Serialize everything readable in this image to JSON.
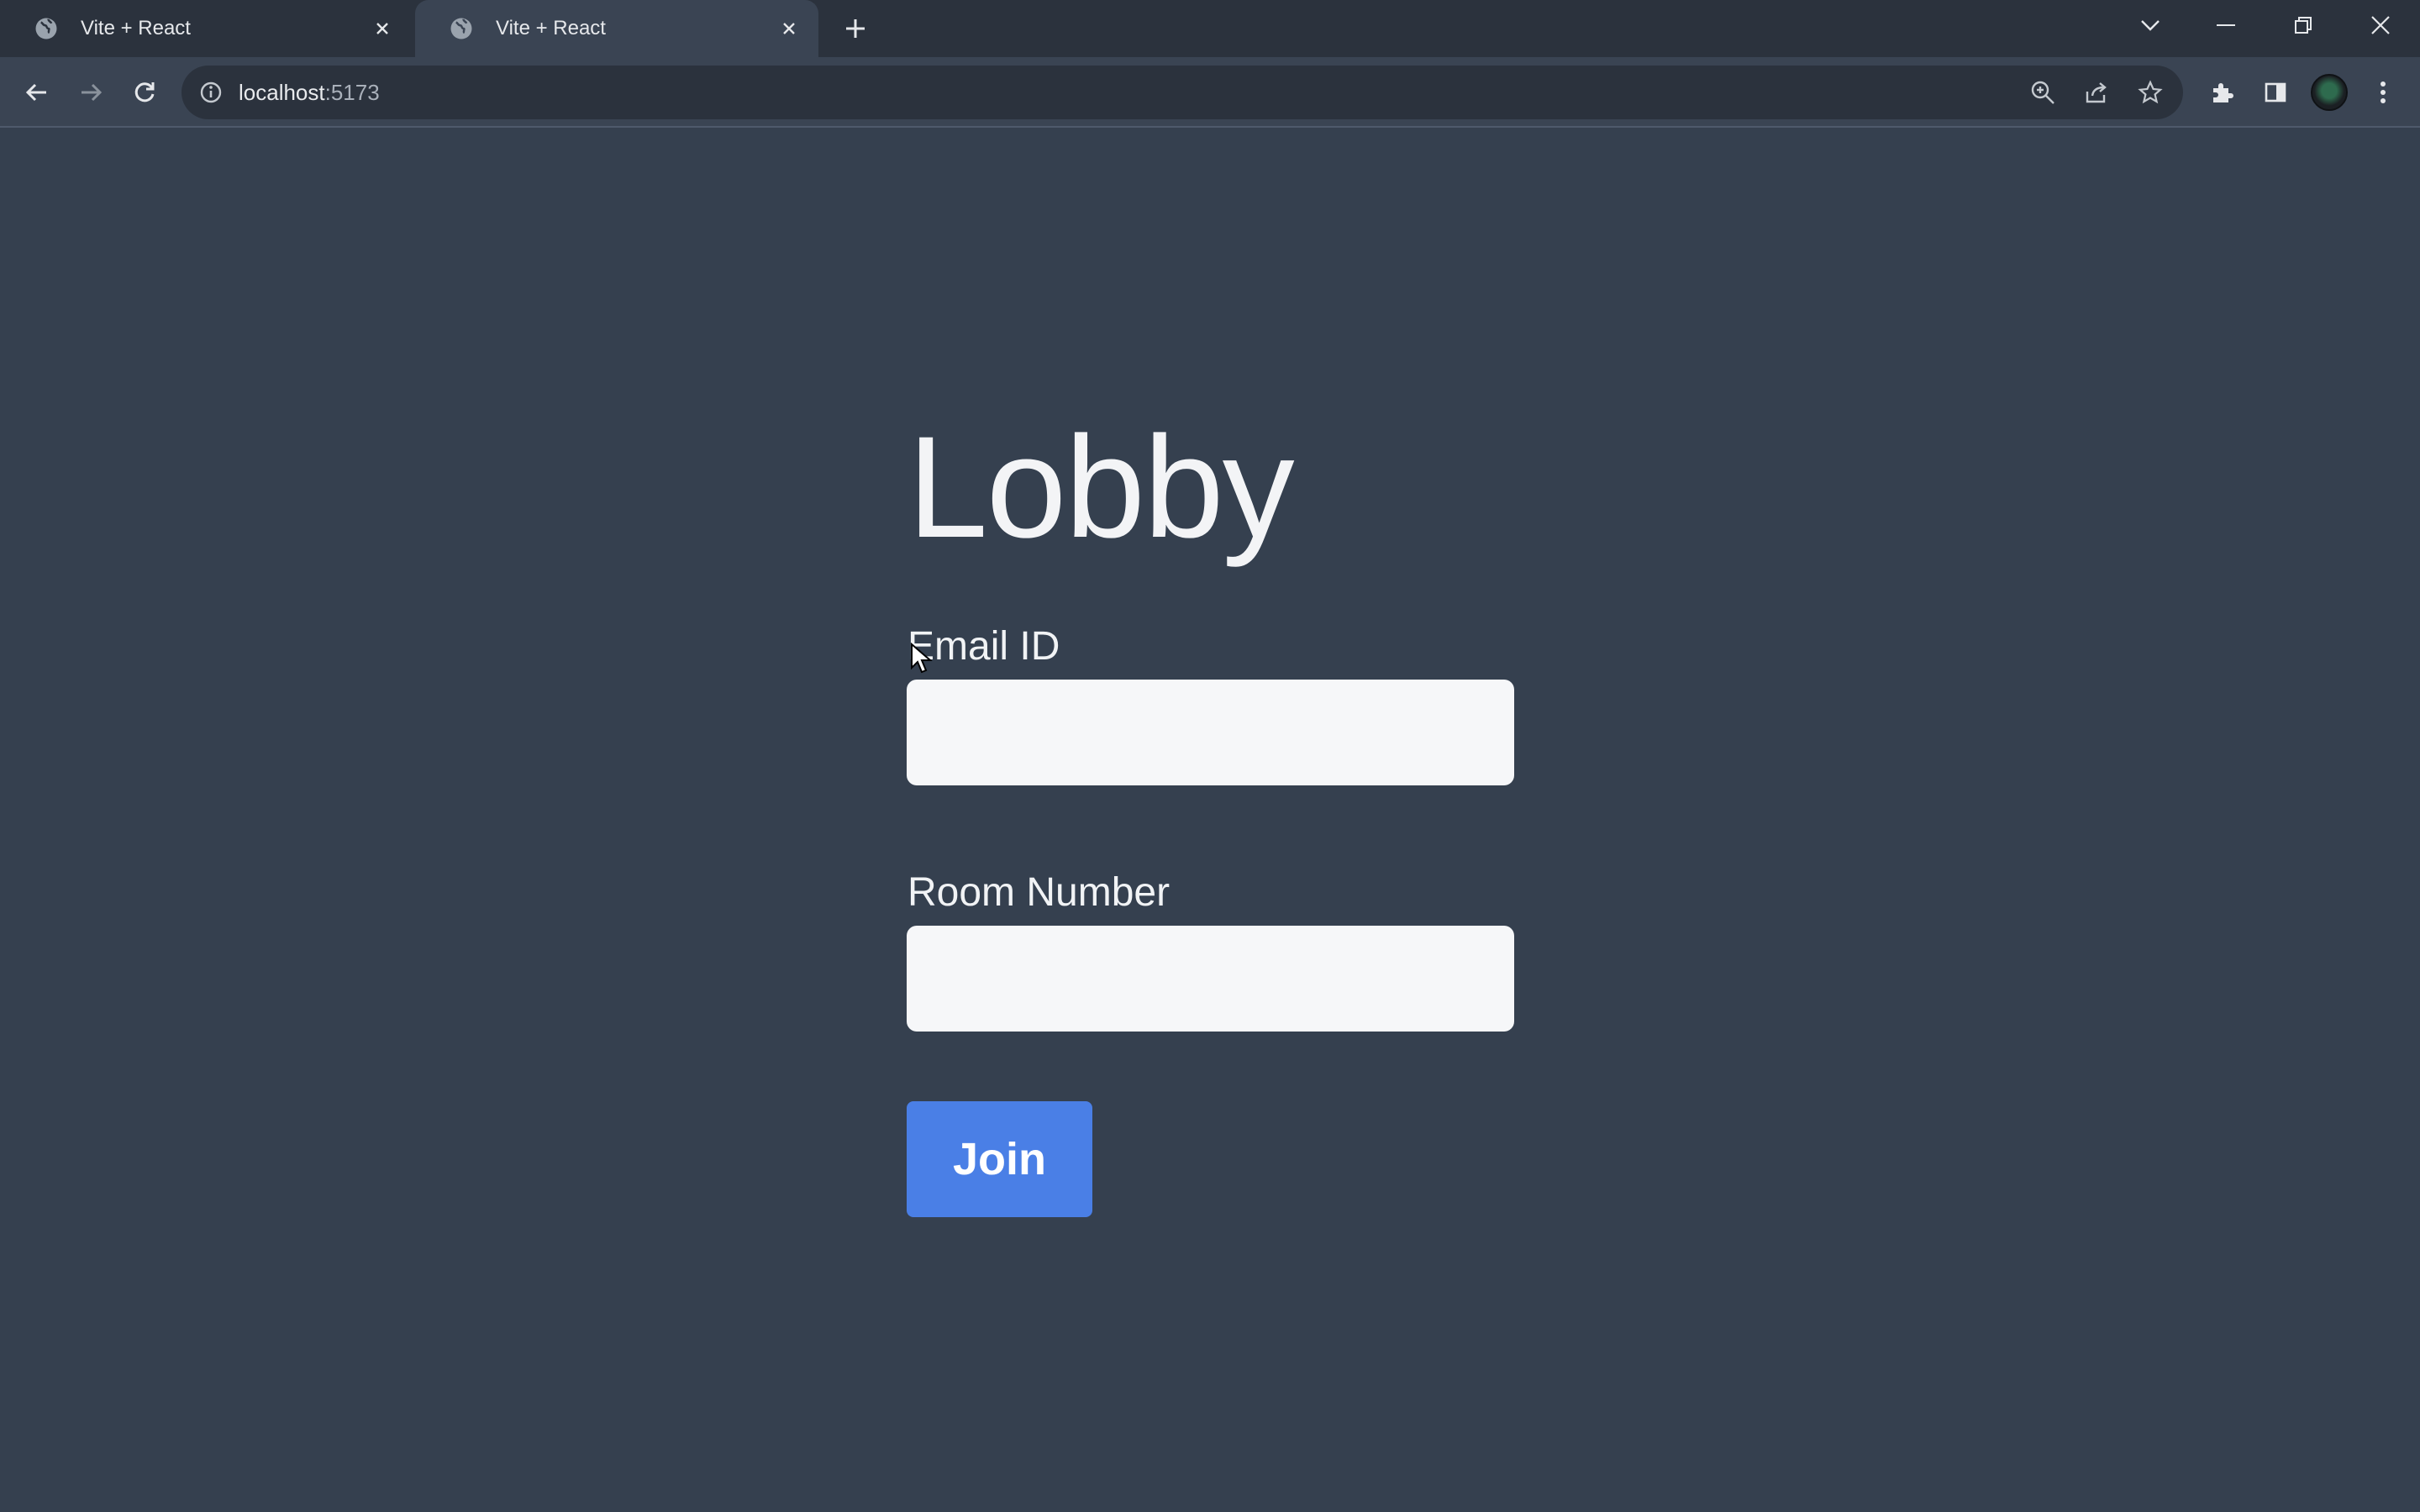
{
  "browser": {
    "tabs": [
      {
        "title": "Vite + React",
        "active": false
      },
      {
        "title": "Vite + React",
        "active": true
      }
    ],
    "url_host": "localhost",
    "url_port": ":5173",
    "colors": {
      "tabstrip": "#2b323d",
      "toolbar": "#3a4453",
      "omnibox": "#2b323d"
    }
  },
  "page": {
    "title": "Lobby",
    "email_label": "Email ID",
    "email_value": "",
    "room_label": "Room Number",
    "room_value": "",
    "join_label": "Join",
    "colors": {
      "background": "#35404f",
      "button": "#4a7fe6",
      "input": "#f6f7f9",
      "text": "#f1f3f5"
    }
  }
}
